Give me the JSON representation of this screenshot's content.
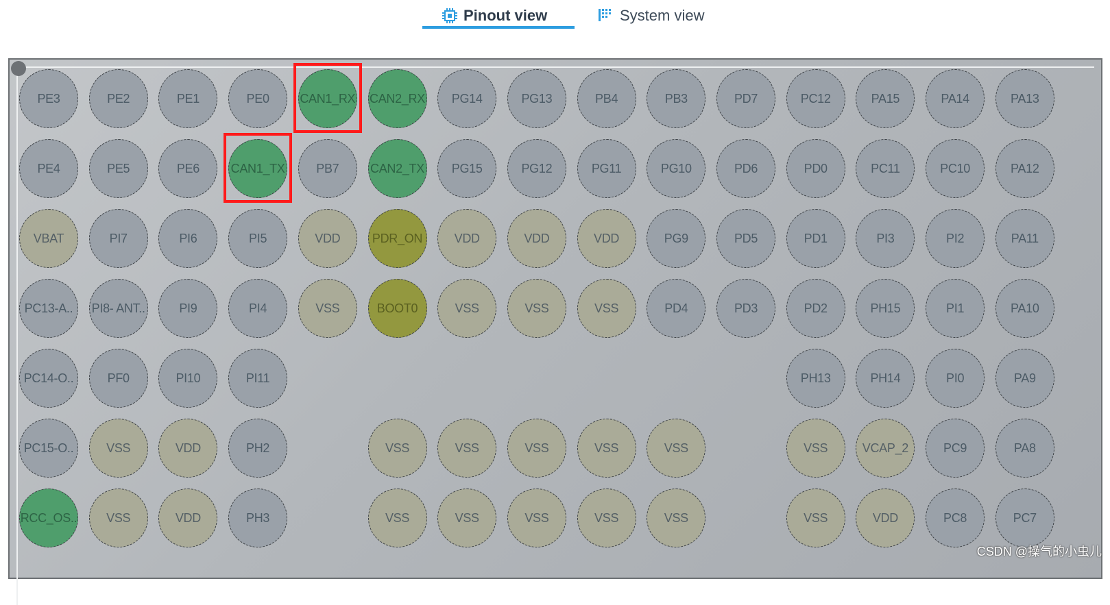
{
  "tabs": {
    "pinout": "Pinout view",
    "system": "System view"
  },
  "colors": {
    "gpio": "#9aa1a9",
    "power": "#aaab98",
    "configured": "#4f9e6c",
    "special": "#93983f",
    "highlight": "#ff1a1a",
    "tab_underline": "#2d9de0"
  },
  "grid": {
    "rows": [
      [
        [
          "PE3",
          "gpio"
        ],
        [
          "PE2",
          "gpio"
        ],
        [
          "PE1",
          "gpio"
        ],
        [
          "PE0",
          "gpio"
        ],
        [
          "CAN1_RX",
          "green"
        ],
        [
          "CAN2_RX",
          "green"
        ],
        [
          "PG14",
          "gpio"
        ],
        [
          "PG13",
          "gpio"
        ],
        [
          "PB4",
          "gpio"
        ],
        [
          "PB3",
          "gpio"
        ],
        [
          "PD7",
          "gpio"
        ],
        [
          "PC12",
          "gpio"
        ],
        [
          "PA15",
          "gpio"
        ],
        [
          "PA14",
          "gpio"
        ],
        [
          "PA13",
          "gpio"
        ]
      ],
      [
        [
          "PE4",
          "gpio"
        ],
        [
          "PE5",
          "gpio"
        ],
        [
          "PE6",
          "gpio"
        ],
        [
          "CAN1_TX",
          "green"
        ],
        [
          "PB7",
          "gpio"
        ],
        [
          "CAN2_TX",
          "green"
        ],
        [
          "PG15",
          "gpio"
        ],
        [
          "PG12",
          "gpio"
        ],
        [
          "PG11",
          "gpio"
        ],
        [
          "PG10",
          "gpio"
        ],
        [
          "PD6",
          "gpio"
        ],
        [
          "PD0",
          "gpio"
        ],
        [
          "PC11",
          "gpio"
        ],
        [
          "PC10",
          "gpio"
        ],
        [
          "PA12",
          "gpio"
        ]
      ],
      [
        [
          "VBAT",
          "power"
        ],
        [
          "PI7",
          "gpio"
        ],
        [
          "PI6",
          "gpio"
        ],
        [
          "PI5",
          "gpio"
        ],
        [
          "VDD",
          "power"
        ],
        [
          "PDR_ON",
          "olive"
        ],
        [
          "VDD",
          "power"
        ],
        [
          "VDD",
          "power"
        ],
        [
          "VDD",
          "power"
        ],
        [
          "PG9",
          "gpio"
        ],
        [
          "PD5",
          "gpio"
        ],
        [
          "PD1",
          "gpio"
        ],
        [
          "PI3",
          "gpio"
        ],
        [
          "PI2",
          "gpio"
        ],
        [
          "PA11",
          "gpio"
        ]
      ],
      [
        [
          "PC13-A..",
          "gpio"
        ],
        [
          "PI8- ANT..",
          "gpio"
        ],
        [
          "PI9",
          "gpio"
        ],
        [
          "PI4",
          "gpio"
        ],
        [
          "VSS",
          "power"
        ],
        [
          "BOOT0",
          "olive"
        ],
        [
          "VSS",
          "power"
        ],
        [
          "VSS",
          "power"
        ],
        [
          "VSS",
          "power"
        ],
        [
          "PD4",
          "gpio"
        ],
        [
          "PD3",
          "gpio"
        ],
        [
          "PD2",
          "gpio"
        ],
        [
          "PH15",
          "gpio"
        ],
        [
          "PI1",
          "gpio"
        ],
        [
          "PA10",
          "gpio"
        ]
      ],
      [
        [
          "PC14-O..",
          "gpio"
        ],
        [
          "PF0",
          "gpio"
        ],
        [
          "PI10",
          "gpio"
        ],
        [
          "PI11",
          "gpio"
        ],
        null,
        null,
        null,
        null,
        null,
        null,
        null,
        [
          "PH13",
          "gpio"
        ],
        [
          "PH14",
          "gpio"
        ],
        [
          "PI0",
          "gpio"
        ],
        [
          "PA9",
          "gpio"
        ]
      ],
      [
        [
          "PC15-O..",
          "gpio"
        ],
        [
          "VSS",
          "power"
        ],
        [
          "VDD",
          "power"
        ],
        [
          "PH2",
          "gpio"
        ],
        null,
        [
          "VSS",
          "power"
        ],
        [
          "VSS",
          "power"
        ],
        [
          "VSS",
          "power"
        ],
        [
          "VSS",
          "power"
        ],
        [
          "VSS",
          "power"
        ],
        null,
        [
          "VSS",
          "power"
        ],
        [
          "VCAP_2",
          "power"
        ],
        [
          "PC9",
          "gpio"
        ],
        [
          "PA8",
          "gpio"
        ]
      ],
      [
        [
          "RCC_OS..",
          "green"
        ],
        [
          "VSS",
          "power"
        ],
        [
          "VDD",
          "power"
        ],
        [
          "PH3",
          "gpio"
        ],
        null,
        [
          "VSS",
          "power"
        ],
        [
          "VSS",
          "power"
        ],
        [
          "VSS",
          "power"
        ],
        [
          "VSS",
          "power"
        ],
        [
          "VSS",
          "power"
        ],
        null,
        [
          "VSS",
          "power"
        ],
        [
          "VDD",
          "power"
        ],
        [
          "PC8",
          "gpio"
        ],
        [
          "PC7",
          "gpio"
        ]
      ]
    ],
    "highlighted": [
      [
        0,
        4
      ],
      [
        1,
        3
      ]
    ]
  },
  "watermark": "CSDN @操气的小虫儿"
}
